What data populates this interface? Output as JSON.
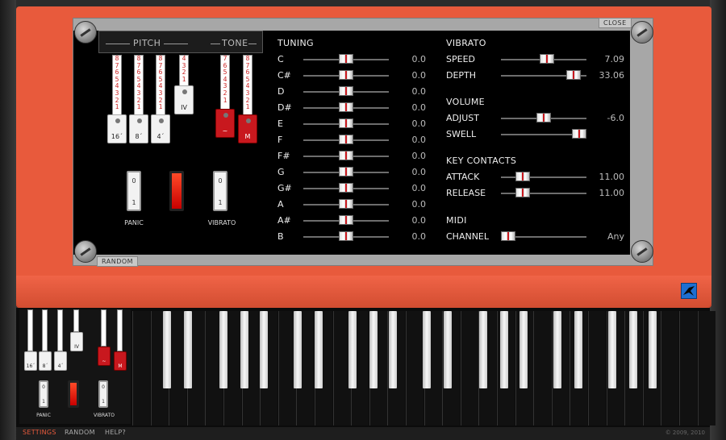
{
  "panel": {
    "close_label": "CLOSE",
    "random_label": "RANDOM"
  },
  "drawbar_header": {
    "pitch": "PITCH",
    "tone": "TONE"
  },
  "drawbars": [
    {
      "label": "16´",
      "color": "#ffffff"
    },
    {
      "label": "8´",
      "color": "#ffffff"
    },
    {
      "label": "4´",
      "color": "#ffffff"
    },
    {
      "label": "IV",
      "color": "#ffffff"
    },
    {
      "label": "~",
      "color": "#c8181e"
    },
    {
      "label": "M",
      "color": "#c8181e"
    }
  ],
  "drawbar_numbers": [
    "8",
    "7",
    "6",
    "5",
    "4",
    "3",
    "2",
    "1"
  ],
  "toggles": {
    "panic": {
      "label": "PANIC",
      "top": "0",
      "bottom": "1"
    },
    "vibrato": {
      "label": "VIBRATO",
      "top": "0",
      "bottom": "1"
    }
  },
  "tuning": {
    "title": "TUNING",
    "notes": [
      {
        "name": "C",
        "value": "0.0"
      },
      {
        "name": "C#",
        "value": "0.0"
      },
      {
        "name": "D",
        "value": "0.0"
      },
      {
        "name": "D#",
        "value": "0.0"
      },
      {
        "name": "E",
        "value": "0.0"
      },
      {
        "name": "F",
        "value": "0.0"
      },
      {
        "name": "F#",
        "value": "0.0"
      },
      {
        "name": "G",
        "value": "0.0"
      },
      {
        "name": "G#",
        "value": "0.0"
      },
      {
        "name": "A",
        "value": "0.0"
      },
      {
        "name": "A#",
        "value": "0.0"
      },
      {
        "name": "B",
        "value": "0.0"
      }
    ]
  },
  "vibrato": {
    "title": "VIBRATO",
    "speed": {
      "label": "SPEED",
      "value": "7.09",
      "level": 0.55
    },
    "depth": {
      "label": "DEPTH",
      "value": "33.06",
      "level": 0.92
    }
  },
  "volume": {
    "title": "VOLUME",
    "adjust": {
      "label": "ADJUST",
      "value": "-6.0",
      "level": 0.5
    },
    "swell": {
      "label": "SWELL",
      "value": "",
      "level": 1.0
    }
  },
  "key_contacts": {
    "title": "KEY CONTACTS",
    "attack": {
      "label": "ATTACK",
      "value": "11.00",
      "level": 0.2
    },
    "release": {
      "label": "RELEASE",
      "value": "11.00",
      "level": 0.2
    }
  },
  "midi": {
    "title": "MIDI",
    "channel": {
      "label": "CHANNEL",
      "value": "Any",
      "level": 0.0
    }
  },
  "bottom": {
    "settings": "SETTINGS",
    "random": "RANDOM",
    "help": "HELP?",
    "copyright": "© 2009, 2010"
  },
  "colors": {
    "accent": "#e85a3c",
    "screen": "#000000",
    "bezel": "#a7a7a7"
  }
}
